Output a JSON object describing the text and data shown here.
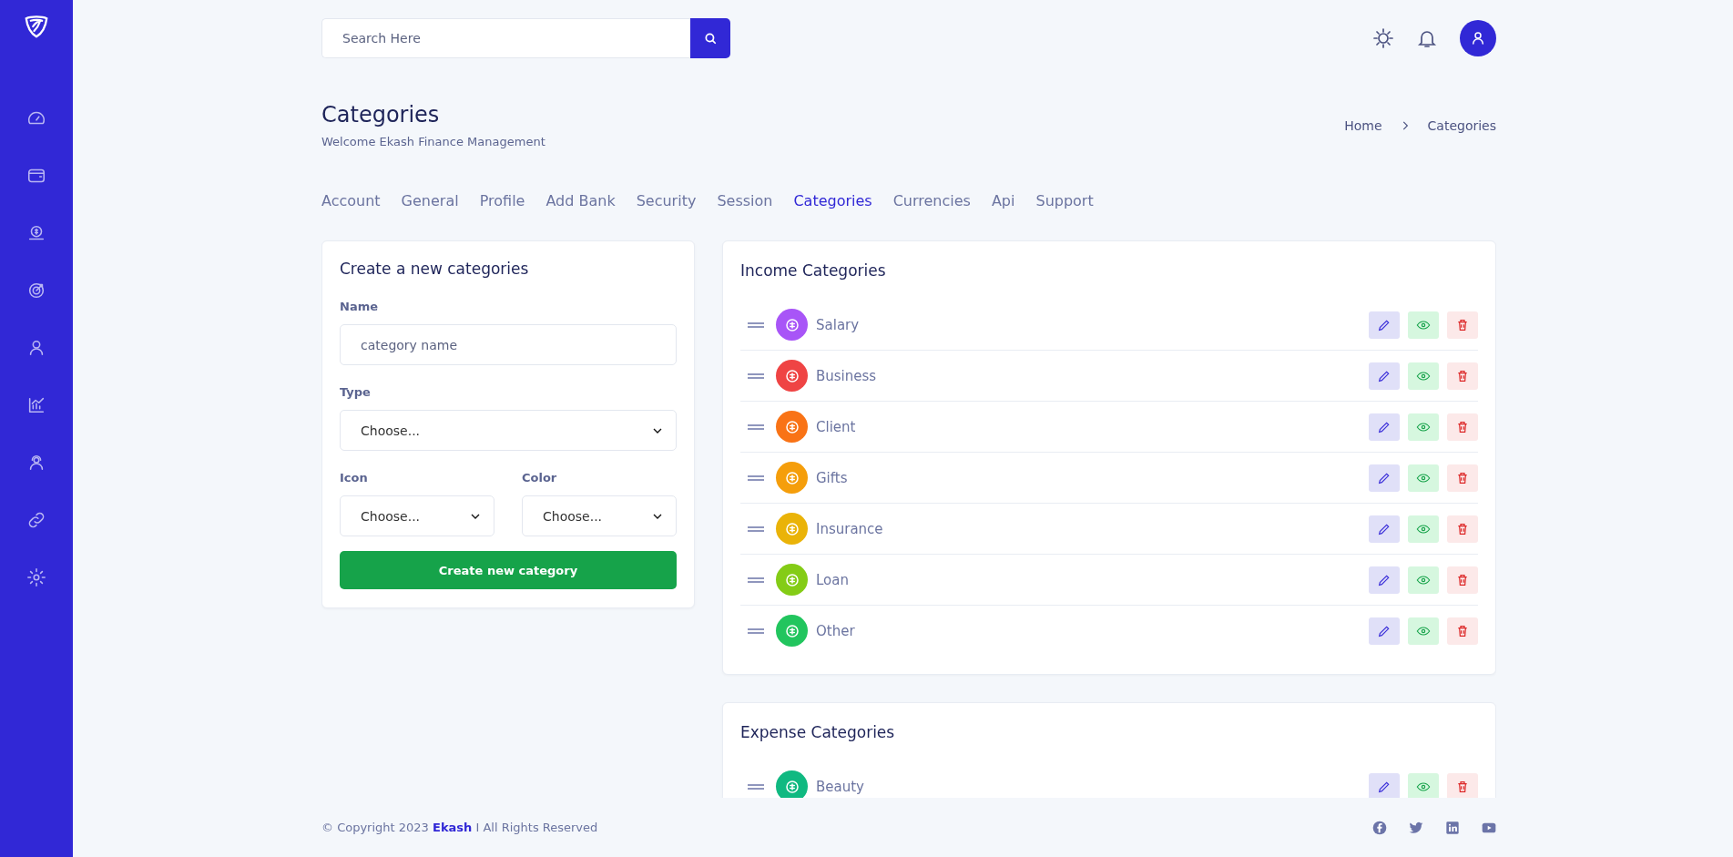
{
  "search": {
    "placeholder": "Search Here"
  },
  "page": {
    "title": "Categories",
    "subtitle": "Welcome Ekash Finance Management"
  },
  "breadcrumb": [
    "Home",
    "Categories"
  ],
  "tabs": [
    {
      "label": "Account",
      "selected": false
    },
    {
      "label": "General",
      "selected": false
    },
    {
      "label": "Profile",
      "selected": false
    },
    {
      "label": "Add Bank",
      "selected": false
    },
    {
      "label": "Security",
      "selected": false
    },
    {
      "label": "Session",
      "selected": false
    },
    {
      "label": "Categories",
      "selected": true
    },
    {
      "label": "Currencies",
      "selected": false
    },
    {
      "label": "Api",
      "selected": false
    },
    {
      "label": "Support",
      "selected": false
    }
  ],
  "form": {
    "title": "Create a new categories",
    "name_label": "Name",
    "name_placeholder": "category name",
    "type_label": "Type",
    "type_value": "Choose...",
    "icon_label": "Icon",
    "icon_value": "Choose...",
    "color_label": "Color",
    "color_value": "Choose...",
    "submit": "Create new category"
  },
  "income": {
    "title": "Income Categories",
    "items": [
      {
        "name": "Salary",
        "color": "#a855f7"
      },
      {
        "name": "Business",
        "color": "#ef4444"
      },
      {
        "name": "Client",
        "color": "#f97316"
      },
      {
        "name": "Gifts",
        "color": "#f59e0b"
      },
      {
        "name": "Insurance",
        "color": "#eab308"
      },
      {
        "name": "Loan",
        "color": "#84cc16"
      },
      {
        "name": "Other",
        "color": "#22c55e"
      }
    ]
  },
  "expense": {
    "title": "Expense Categories",
    "items": [
      {
        "name": "Beauty",
        "color": "#10b981"
      }
    ]
  },
  "footer": {
    "prefix": "© Copyright 2023 ",
    "brand": "Ekash",
    "suffix": " I All Rights Reserved"
  }
}
